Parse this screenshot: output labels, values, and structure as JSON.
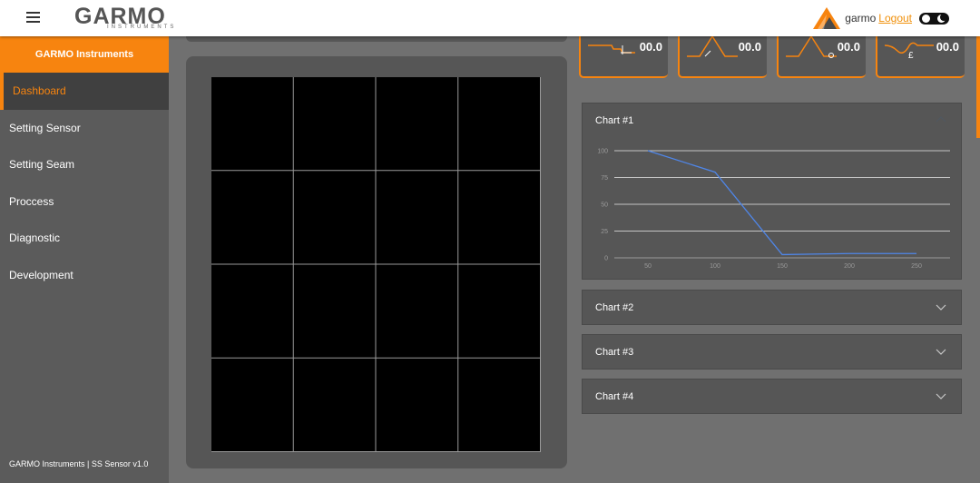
{
  "header": {
    "logo_text": "GARMO",
    "logo_subtext": "INSTRUMENTS",
    "username": "garmo",
    "logout_label": "Logout"
  },
  "sidebar": {
    "brand": "GARMO Instruments",
    "items": [
      {
        "label": "Dashboard",
        "active": true
      },
      {
        "label": "Setting Sensor",
        "active": false
      },
      {
        "label": "Setting Seam",
        "active": false
      },
      {
        "label": "Proccess",
        "active": false
      },
      {
        "label": "Diagnostic",
        "active": false
      },
      {
        "label": "Development",
        "active": false
      }
    ],
    "footer": "GARMO Instruments | SS Sensor v1.0"
  },
  "indicators": [
    {
      "value": "00.0",
      "icon": "step-profile-icon"
    },
    {
      "value": "00.0",
      "icon": "bump-profile-icon"
    },
    {
      "value": "00.0",
      "icon": "bump-gap-profile-icon"
    },
    {
      "value": "00.0",
      "icon": "wave-profile-icon"
    }
  ],
  "charts": [
    {
      "title": "Chart #1",
      "expanded": true
    },
    {
      "title": "Chart #2",
      "expanded": false
    },
    {
      "title": "Chart #3",
      "expanded": false
    },
    {
      "title": "Chart #4",
      "expanded": false
    }
  ],
  "colors": {
    "accent": "#f7840f",
    "line": "#4f86e8"
  },
  "chart_data": {
    "type": "line",
    "title": "",
    "xlabel": "",
    "ylabel": "",
    "x": [
      50,
      100,
      150,
      200,
      250
    ],
    "series": [
      {
        "values": [
          100,
          80,
          3,
          4,
          4
        ]
      }
    ],
    "xticks": [
      "50",
      "100",
      "150",
      "200",
      "250"
    ],
    "yticks": [
      "0",
      "25",
      "50",
      "75",
      "100"
    ],
    "ylim": [
      0,
      100
    ],
    "xlim": [
      25,
      275
    ],
    "grid": true
  }
}
